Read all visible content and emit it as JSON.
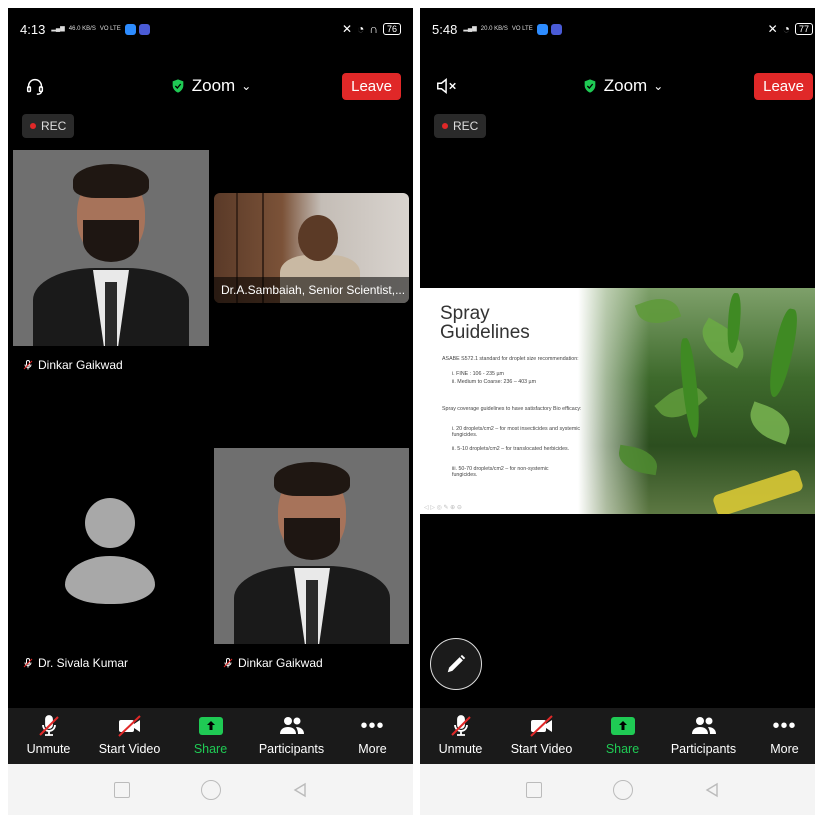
{
  "left": {
    "status": {
      "time": "4:13",
      "net_speed": "46.0 KB/S",
      "net_tag": "VO LTE",
      "battery": "76"
    },
    "title": "Zoom",
    "leave_label": "Leave",
    "rec_label": "REC",
    "tiles": [
      {
        "name": "Dinkar Gaikwad"
      },
      {
        "name": "Dr.A.Sambaiah, Senior Scientist,..."
      },
      {
        "name": "Dr. Sivala Kumar"
      },
      {
        "name": "Dinkar Gaikwad"
      }
    ],
    "toolbar": {
      "unmute": "Unmute",
      "start_video": "Start Video",
      "share": "Share",
      "participants": "Participants",
      "more": "More"
    }
  },
  "right": {
    "status": {
      "time": "5:48",
      "net_speed": "20.0 KB/S",
      "net_tag": "VO LTE",
      "battery": "77"
    },
    "title": "Zoom",
    "leave_label": "Leave",
    "rec_label": "REC",
    "slide": {
      "title_line1": "Spray",
      "title_line2": "Guidelines",
      "intro": "ASABE S572.1 standard for droplet size recommendation:",
      "item1": "i.   FINE : 106 - 235 µm",
      "item2": "ii.  Medium to Coarse: 236 – 403 µm",
      "coverage": "Spray coverage guidelines to have satisfactory Bio efficacy:",
      "c1": "i.   20 droplets/cm2 – for most insecticides and systemic fungicides.",
      "c2": "ii.  5-10 droplets/cm2 – for translocated herbicides.",
      "c3": "iii. 50-70 droplets/cm2 – for non-systemic fungicides."
    },
    "toolbar": {
      "unmute": "Unmute",
      "start_video": "Start Video",
      "share": "Share",
      "participants": "Participants",
      "more": "More"
    }
  },
  "colors": {
    "leave": "#e02828",
    "share_green": "#1fca54",
    "shield_green": "#1fca54",
    "rec_red": "#e02828",
    "status_blue": "#2d8cff"
  },
  "icons": [
    "headset-icon",
    "speaker-muted-icon",
    "shield-check-icon",
    "chevron-down-icon",
    "mic-muted-icon",
    "video-off-icon",
    "share-up-arrow-icon",
    "participants-icon",
    "more-dots-icon",
    "pen-icon"
  ]
}
